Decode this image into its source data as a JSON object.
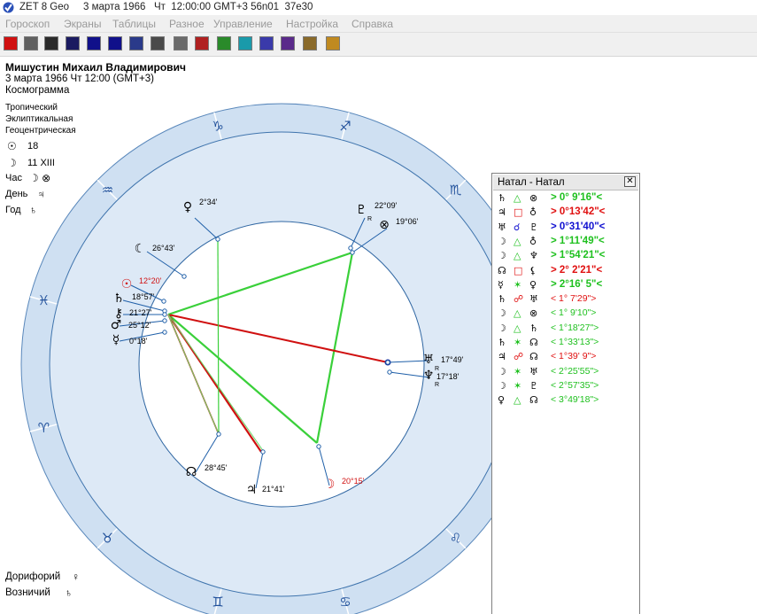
{
  "window": {
    "title": "ZET 8 Geo     3 марта 1966   Чт  12:00:00 GMT+3 56n01  37e30"
  },
  "menu": [
    "Гороскоп",
    "Экраны",
    "Таблицы",
    "Разное",
    "Управление",
    "Настройка",
    "Справка"
  ],
  "toolbar": {
    "buttons": [
      {
        "name": "horoscope-tool",
        "color": "#d01010"
      },
      {
        "name": "table-tool",
        "color": "#606060"
      },
      {
        "name": "wheel-tool",
        "color": "#2a2a2a"
      },
      {
        "name": "chart-tool",
        "color": "#1a1a60"
      },
      {
        "name": "star-map-tool",
        "color": "#10108a"
      },
      {
        "name": "planets-tool",
        "color": "#10108a"
      },
      {
        "name": "aspects-tool",
        "color": "#2a3a8a"
      },
      {
        "name": "grid-tool",
        "color": "#4a4a4a"
      },
      {
        "name": "document-tool",
        "color": "#6a6a6a"
      },
      {
        "name": "bars-tool",
        "color": "#b02020"
      },
      {
        "name": "graph-tool",
        "color": "#2a8a2a"
      },
      {
        "name": "transit-tool",
        "color": "#1a9aaa"
      },
      {
        "name": "calendar-tool",
        "color": "#3a3aaa"
      },
      {
        "name": "circle-tool",
        "color": "#5a2a8a"
      },
      {
        "name": "tools-tool",
        "color": "#8a6a2a"
      },
      {
        "name": "person-tool",
        "color": "#c08a20"
      }
    ]
  },
  "person": {
    "name": "Мишустин Михаил Владимирович",
    "datetime": "3 марта 1966  Чт  12:00 (GMT+3)",
    "chart_kind": "Космограмма"
  },
  "settings": [
    "Тропический",
    "Эклиптикальная",
    "Геоцентрическая"
  ],
  "day_info": {
    "sun": {
      "glyph": "☉",
      "value": "18"
    },
    "moon": {
      "glyph": "☽",
      "value": "11 XIII"
    },
    "hour": {
      "label": "Час",
      "glyph": "☽ ⊗"
    },
    "day": {
      "label": "День",
      "glyph": "♃"
    },
    "year": {
      "label": "Год",
      "glyph": "♄"
    }
  },
  "bottom": {
    "doriphory": {
      "label": "Дорифорий",
      "glyph": "♀"
    },
    "vozn": {
      "label": "Возничий",
      "glyph": "♄"
    }
  },
  "zodiac": [
    {
      "sign": "capricorn",
      "glyph": "♑"
    },
    {
      "sign": "sagittarius",
      "glyph": "♐"
    },
    {
      "sign": "scorpio",
      "glyph": "♏"
    },
    {
      "sign": "libra",
      "glyph": "♎"
    },
    {
      "sign": "virgo",
      "glyph": "♍"
    },
    {
      "sign": "leo",
      "glyph": "♌"
    },
    {
      "sign": "cancer",
      "glyph": "♋"
    },
    {
      "sign": "gemini",
      "glyph": "♊"
    },
    {
      "sign": "taurus",
      "glyph": "♉"
    },
    {
      "sign": "aries",
      "glyph": "♈"
    },
    {
      "sign": "pisces",
      "glyph": "♓"
    },
    {
      "sign": "aquarius",
      "glyph": "♒"
    }
  ],
  "planets": [
    {
      "name": "venus",
      "glyph": "♀",
      "degree": "2°34'",
      "retro": "",
      "color": "#000000"
    },
    {
      "name": "pluto",
      "glyph": "♇",
      "degree": "22°09'",
      "retro": "R",
      "color": "#000000"
    },
    {
      "name": "fortune",
      "glyph": "⊗",
      "degree": "19°06'",
      "retro": "",
      "color": "#000000"
    },
    {
      "name": "lilith",
      "glyph": "☾",
      "degree": "26°43'",
      "retro": "",
      "color": "#000000"
    },
    {
      "name": "sun",
      "glyph": "☉",
      "degree": "12°20'",
      "retro": "",
      "color": "#d01010"
    },
    {
      "name": "saturn",
      "glyph": "♄",
      "degree": "18°57'",
      "retro": "",
      "color": "#000000"
    },
    {
      "name": "chiron",
      "glyph": "⚷",
      "degree": "21°27'",
      "retro": "",
      "color": "#000000"
    },
    {
      "name": "mars",
      "glyph": "♂",
      "degree": "25°12'",
      "retro": "",
      "color": "#000000"
    },
    {
      "name": "mercury",
      "glyph": "☿",
      "degree": "0°18'",
      "retro": "",
      "color": "#000000"
    },
    {
      "name": "uranus",
      "glyph": "♅",
      "degree": "17°49'",
      "retro": "R",
      "color": "#000000"
    },
    {
      "name": "neptune",
      "glyph": "♆",
      "degree": "17°18'",
      "retro": "R",
      "color": "#000000"
    },
    {
      "name": "node",
      "glyph": "☊",
      "degree": "28°45'",
      "retro": "",
      "color": "#000000"
    },
    {
      "name": "jupiter",
      "glyph": "♃",
      "degree": "21°41'",
      "retro": "",
      "color": "#000000"
    },
    {
      "name": "moon",
      "glyph": "☽",
      "degree": "20°15'",
      "retro": "",
      "color": "#d01010"
    }
  ],
  "panel": {
    "title": "Натал - Натал",
    "close": "✕",
    "aspects": [
      {
        "p1": "♄",
        "asp": "△",
        "p2": "⊗",
        "value": "> 0° 9'16\"<",
        "color": "#1ec01e",
        "bold": true
      },
      {
        "p1": "♃",
        "asp": "□",
        "p2": "♁",
        "value": "> 0°13'42\"<",
        "color": "#e01010",
        "bold": true
      },
      {
        "p1": "♅",
        "asp": "☌",
        "p2": "♇",
        "value": "> 0°31'40\"<",
        "color": "#1010d0",
        "bold": true
      },
      {
        "p1": "☽",
        "asp": "△",
        "p2": "♁",
        "value": "> 1°11'49\"<",
        "color": "#1ec01e",
        "bold": true
      },
      {
        "p1": "☽",
        "asp": "△",
        "p2": "♆",
        "value": "> 1°54'21\"<",
        "color": "#1ec01e",
        "bold": true
      },
      {
        "p1": "☊",
        "asp": "□",
        "p2": "⚸",
        "value": "> 2° 2'21\"<",
        "color": "#e01010",
        "bold": true
      },
      {
        "p1": "☿",
        "asp": "✶",
        "p2": "♀",
        "value": "> 2°16' 5\"<",
        "color": "#1ec01e",
        "bold": true
      },
      {
        "p1": "♄",
        "asp": "☍",
        "p2": "♅",
        "value": "< 1° 7'29\">",
        "color": "#e01010",
        "bold": false
      },
      {
        "p1": "☽",
        "asp": "△",
        "p2": "⊗",
        "value": "< 1° 9'10\">",
        "color": "#1ec01e",
        "bold": false
      },
      {
        "p1": "☽",
        "asp": "△",
        "p2": "♄",
        "value": "< 1°18'27\">",
        "color": "#1ec01e",
        "bold": false
      },
      {
        "p1": "♄",
        "asp": "✶",
        "p2": "☊",
        "value": "< 1°33'13\">",
        "color": "#1ec01e",
        "bold": false
      },
      {
        "p1": "♃",
        "asp": "☍",
        "p2": "☊",
        "value": "< 1°39' 9\">",
        "color": "#e01010",
        "bold": false
      },
      {
        "p1": "☽",
        "asp": "✶",
        "p2": "♅",
        "value": "< 2°25'55\">",
        "color": "#1ec01e",
        "bold": false
      },
      {
        "p1": "☽",
        "asp": "✶",
        "p2": "♇",
        "value": "< 2°57'35\">",
        "color": "#1ec01e",
        "bold": false
      },
      {
        "p1": "♀",
        "asp": "△",
        "p2": "☊",
        "value": "< 3°49'18\">",
        "color": "#1ec01e",
        "bold": false
      }
    ]
  }
}
